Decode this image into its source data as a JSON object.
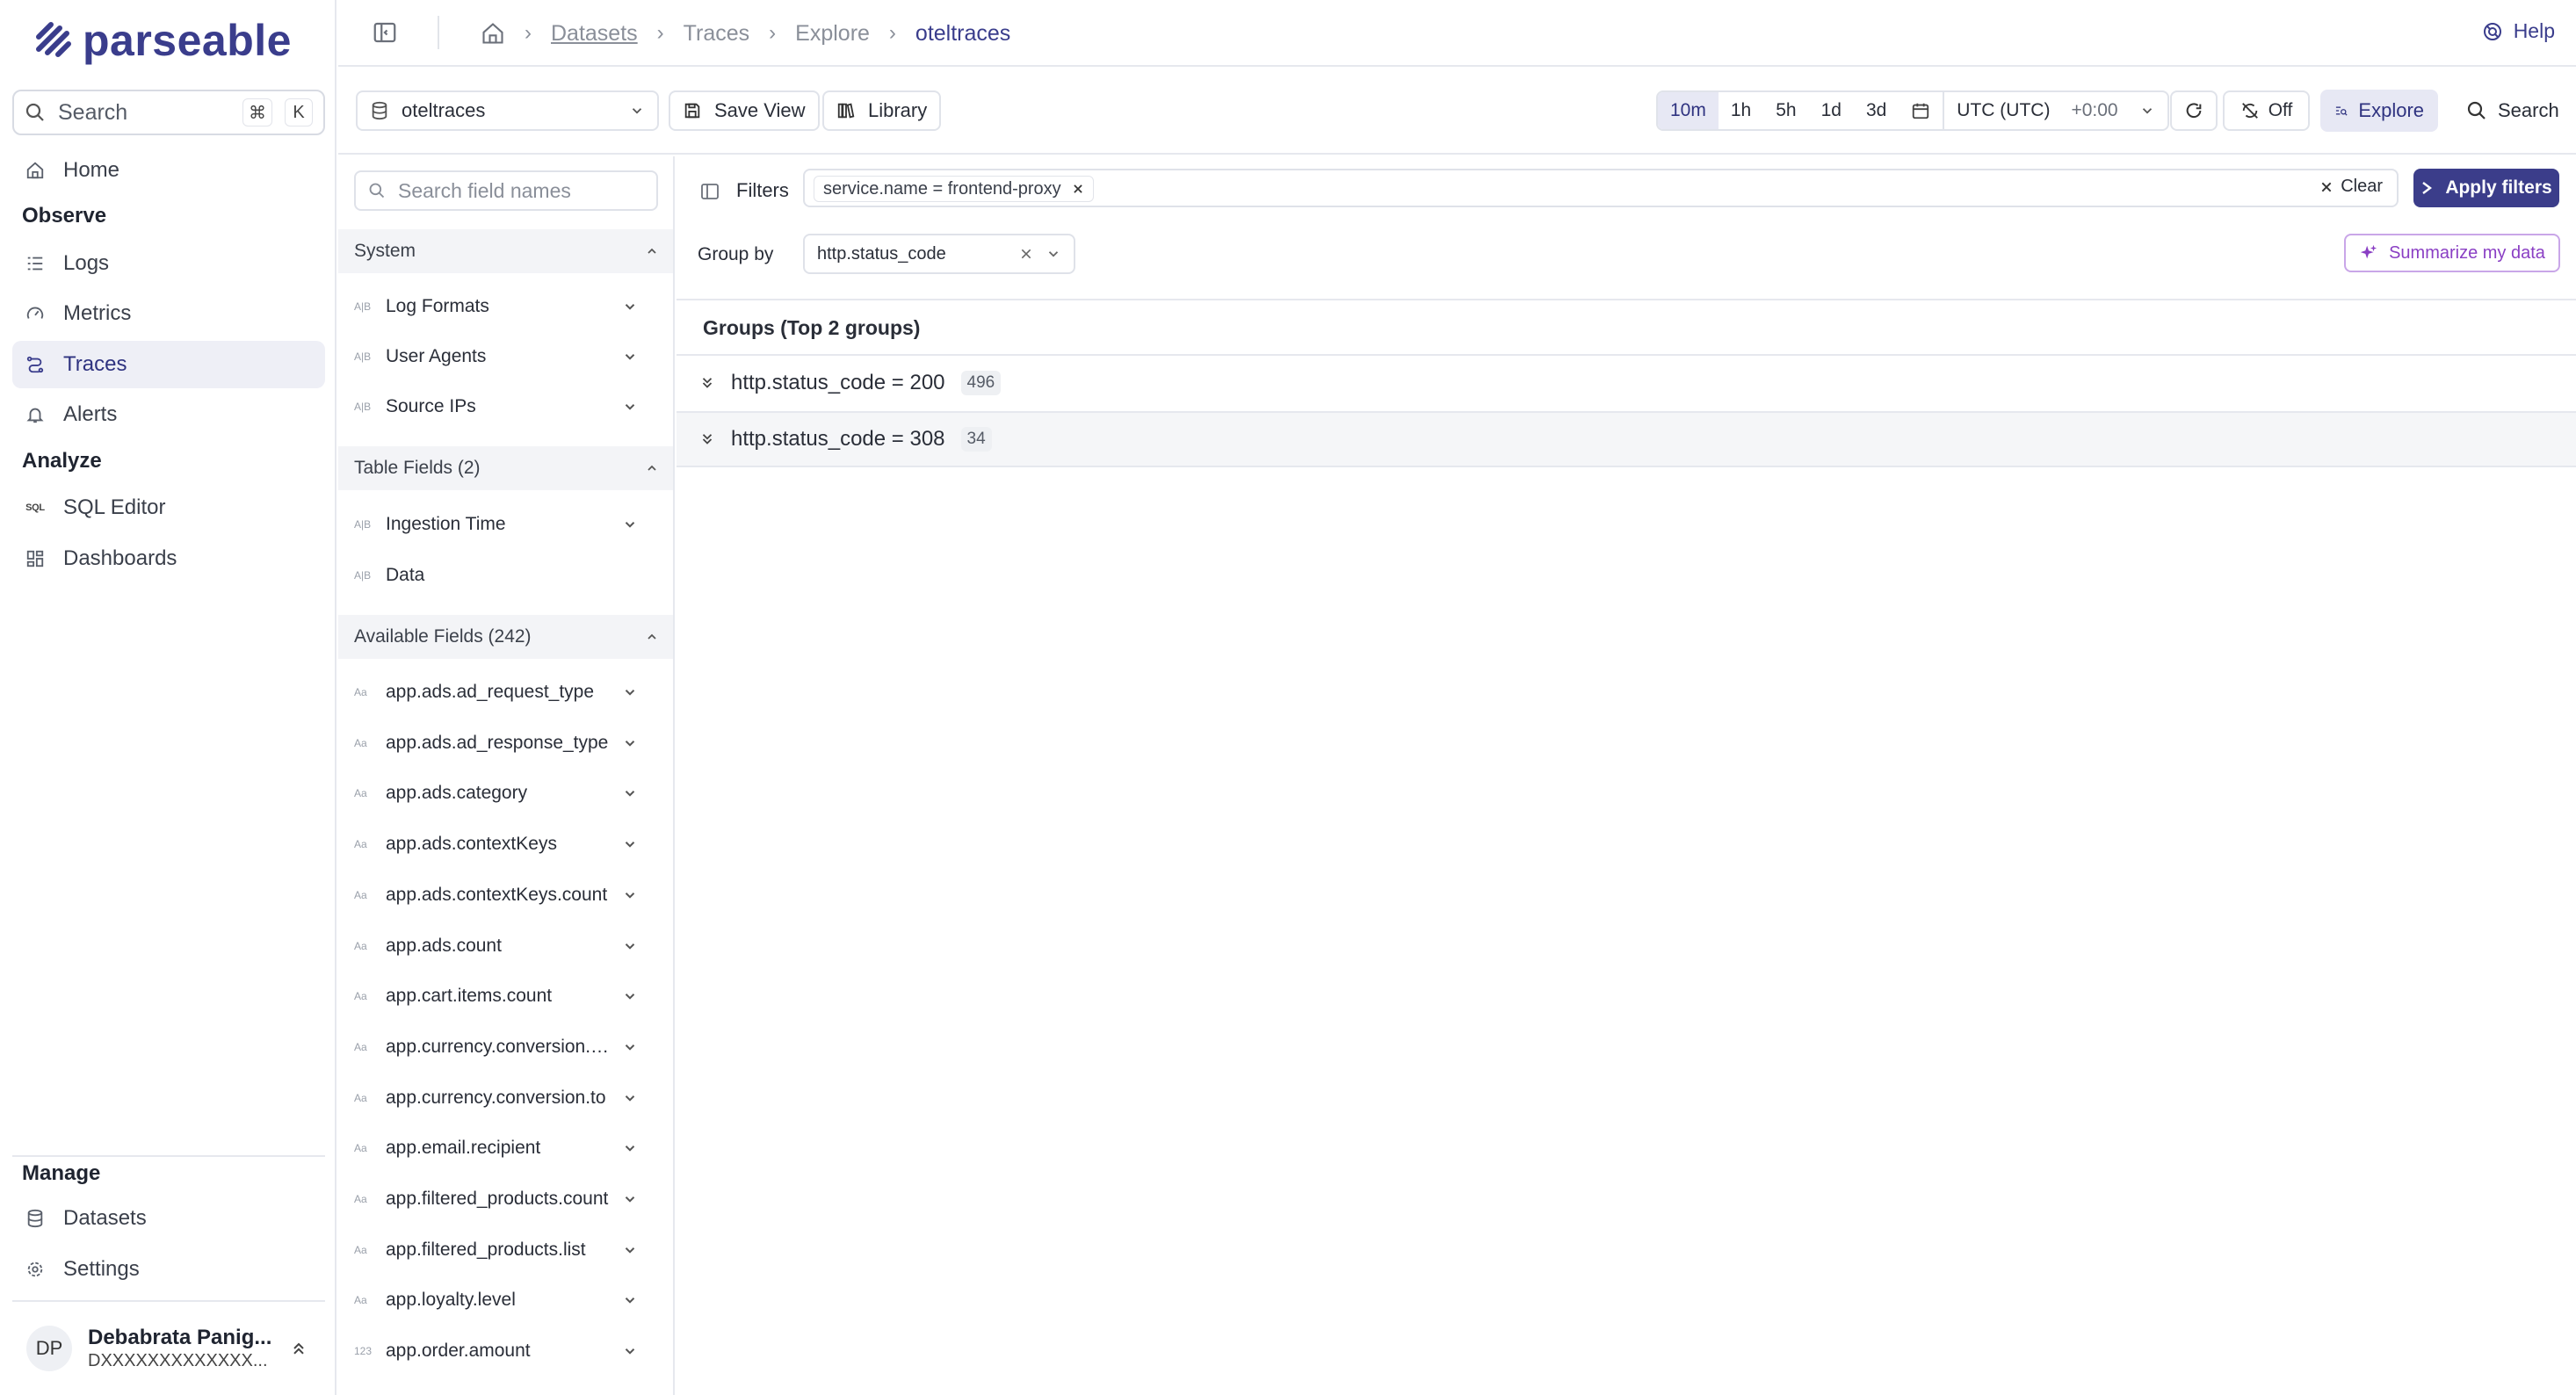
{
  "brand": {
    "name": "parseable",
    "color": "#3a3d8c"
  },
  "nav": {
    "search_label": "Search",
    "shortcut": [
      "⌘",
      "K"
    ],
    "home": "Home",
    "observe_title": "Observe",
    "logs": "Logs",
    "metrics": "Metrics",
    "traces": "Traces",
    "alerts": "Alerts",
    "analyze_title": "Analyze",
    "sql_editor": "SQL Editor",
    "sql_icon_text": "SQL",
    "dashboards": "Dashboards",
    "manage_title": "Manage",
    "datasets": "Datasets",
    "settings": "Settings",
    "active": "Traces"
  },
  "user": {
    "initials": "DP",
    "name": "Debabrata Panig...",
    "id": "DXXXXXXXXXXXXX..."
  },
  "breadcrumb": {
    "datasets": "Datasets",
    "traces": "Traces",
    "explore": "Explore",
    "current": "oteltraces"
  },
  "help_label": "Help",
  "toolbar": {
    "dataset": "oteltraces",
    "save_view": "Save View",
    "library": "Library",
    "time_ranges": [
      "10m",
      "1h",
      "5h",
      "1d",
      "3d"
    ],
    "active_range": "10m",
    "timezone": "UTC (UTC)",
    "offset": "+0:00",
    "refresh_label": "Off",
    "explore": "Explore",
    "search": "Search"
  },
  "fields_panel": {
    "search_placeholder": "Search field names",
    "sections": [
      {
        "title": "System",
        "items": [
          {
            "type": "A|B",
            "name": "Log Formats",
            "expandable": true
          },
          {
            "type": "A|B",
            "name": "User Agents",
            "expandable": true
          },
          {
            "type": "A|B",
            "name": "Source IPs",
            "expandable": true
          }
        ]
      },
      {
        "title": "Table Fields (2)",
        "items": [
          {
            "type": "A|B",
            "name": "Ingestion Time",
            "expandable": true
          },
          {
            "type": "A|B",
            "name": "Data",
            "expandable": false
          }
        ]
      },
      {
        "title": "Available Fields (242)",
        "items": [
          {
            "type": "Aa",
            "name": "app.ads.ad_request_type",
            "expandable": true
          },
          {
            "type": "Aa",
            "name": "app.ads.ad_response_type",
            "expandable": true
          },
          {
            "type": "Aa",
            "name": "app.ads.category",
            "expandable": true
          },
          {
            "type": "Aa",
            "name": "app.ads.contextKeys",
            "expandable": true
          },
          {
            "type": "Aa",
            "name": "app.ads.contextKeys.count",
            "expandable": true
          },
          {
            "type": "Aa",
            "name": "app.ads.count",
            "expandable": true
          },
          {
            "type": "Aa",
            "name": "app.cart.items.count",
            "expandable": true
          },
          {
            "type": "Aa",
            "name": "app.currency.conversion.…",
            "expandable": true
          },
          {
            "type": "Aa",
            "name": "app.currency.conversion.to",
            "expandable": true
          },
          {
            "type": "Aa",
            "name": "app.email.recipient",
            "expandable": true
          },
          {
            "type": "Aa",
            "name": "app.filtered_products.count",
            "expandable": true
          },
          {
            "type": "Aa",
            "name": "app.filtered_products.list",
            "expandable": true
          },
          {
            "type": "Aa",
            "name": "app.loyalty.level",
            "expandable": true
          },
          {
            "type": "123",
            "name": "app.order.amount",
            "expandable": true
          }
        ]
      }
    ]
  },
  "filters": {
    "label": "Filters",
    "chip": "service.name = frontend-proxy",
    "clear": "Clear",
    "apply": "Apply filters"
  },
  "group_by": {
    "label": "Group by",
    "value": "http.status_code"
  },
  "summarize": "Summarize my data",
  "groups": {
    "title": "Groups (Top 2 groups)",
    "rows": [
      {
        "label": "http.status_code = 200",
        "count": "496"
      },
      {
        "label": "http.status_code = 308",
        "count": "34"
      }
    ]
  }
}
